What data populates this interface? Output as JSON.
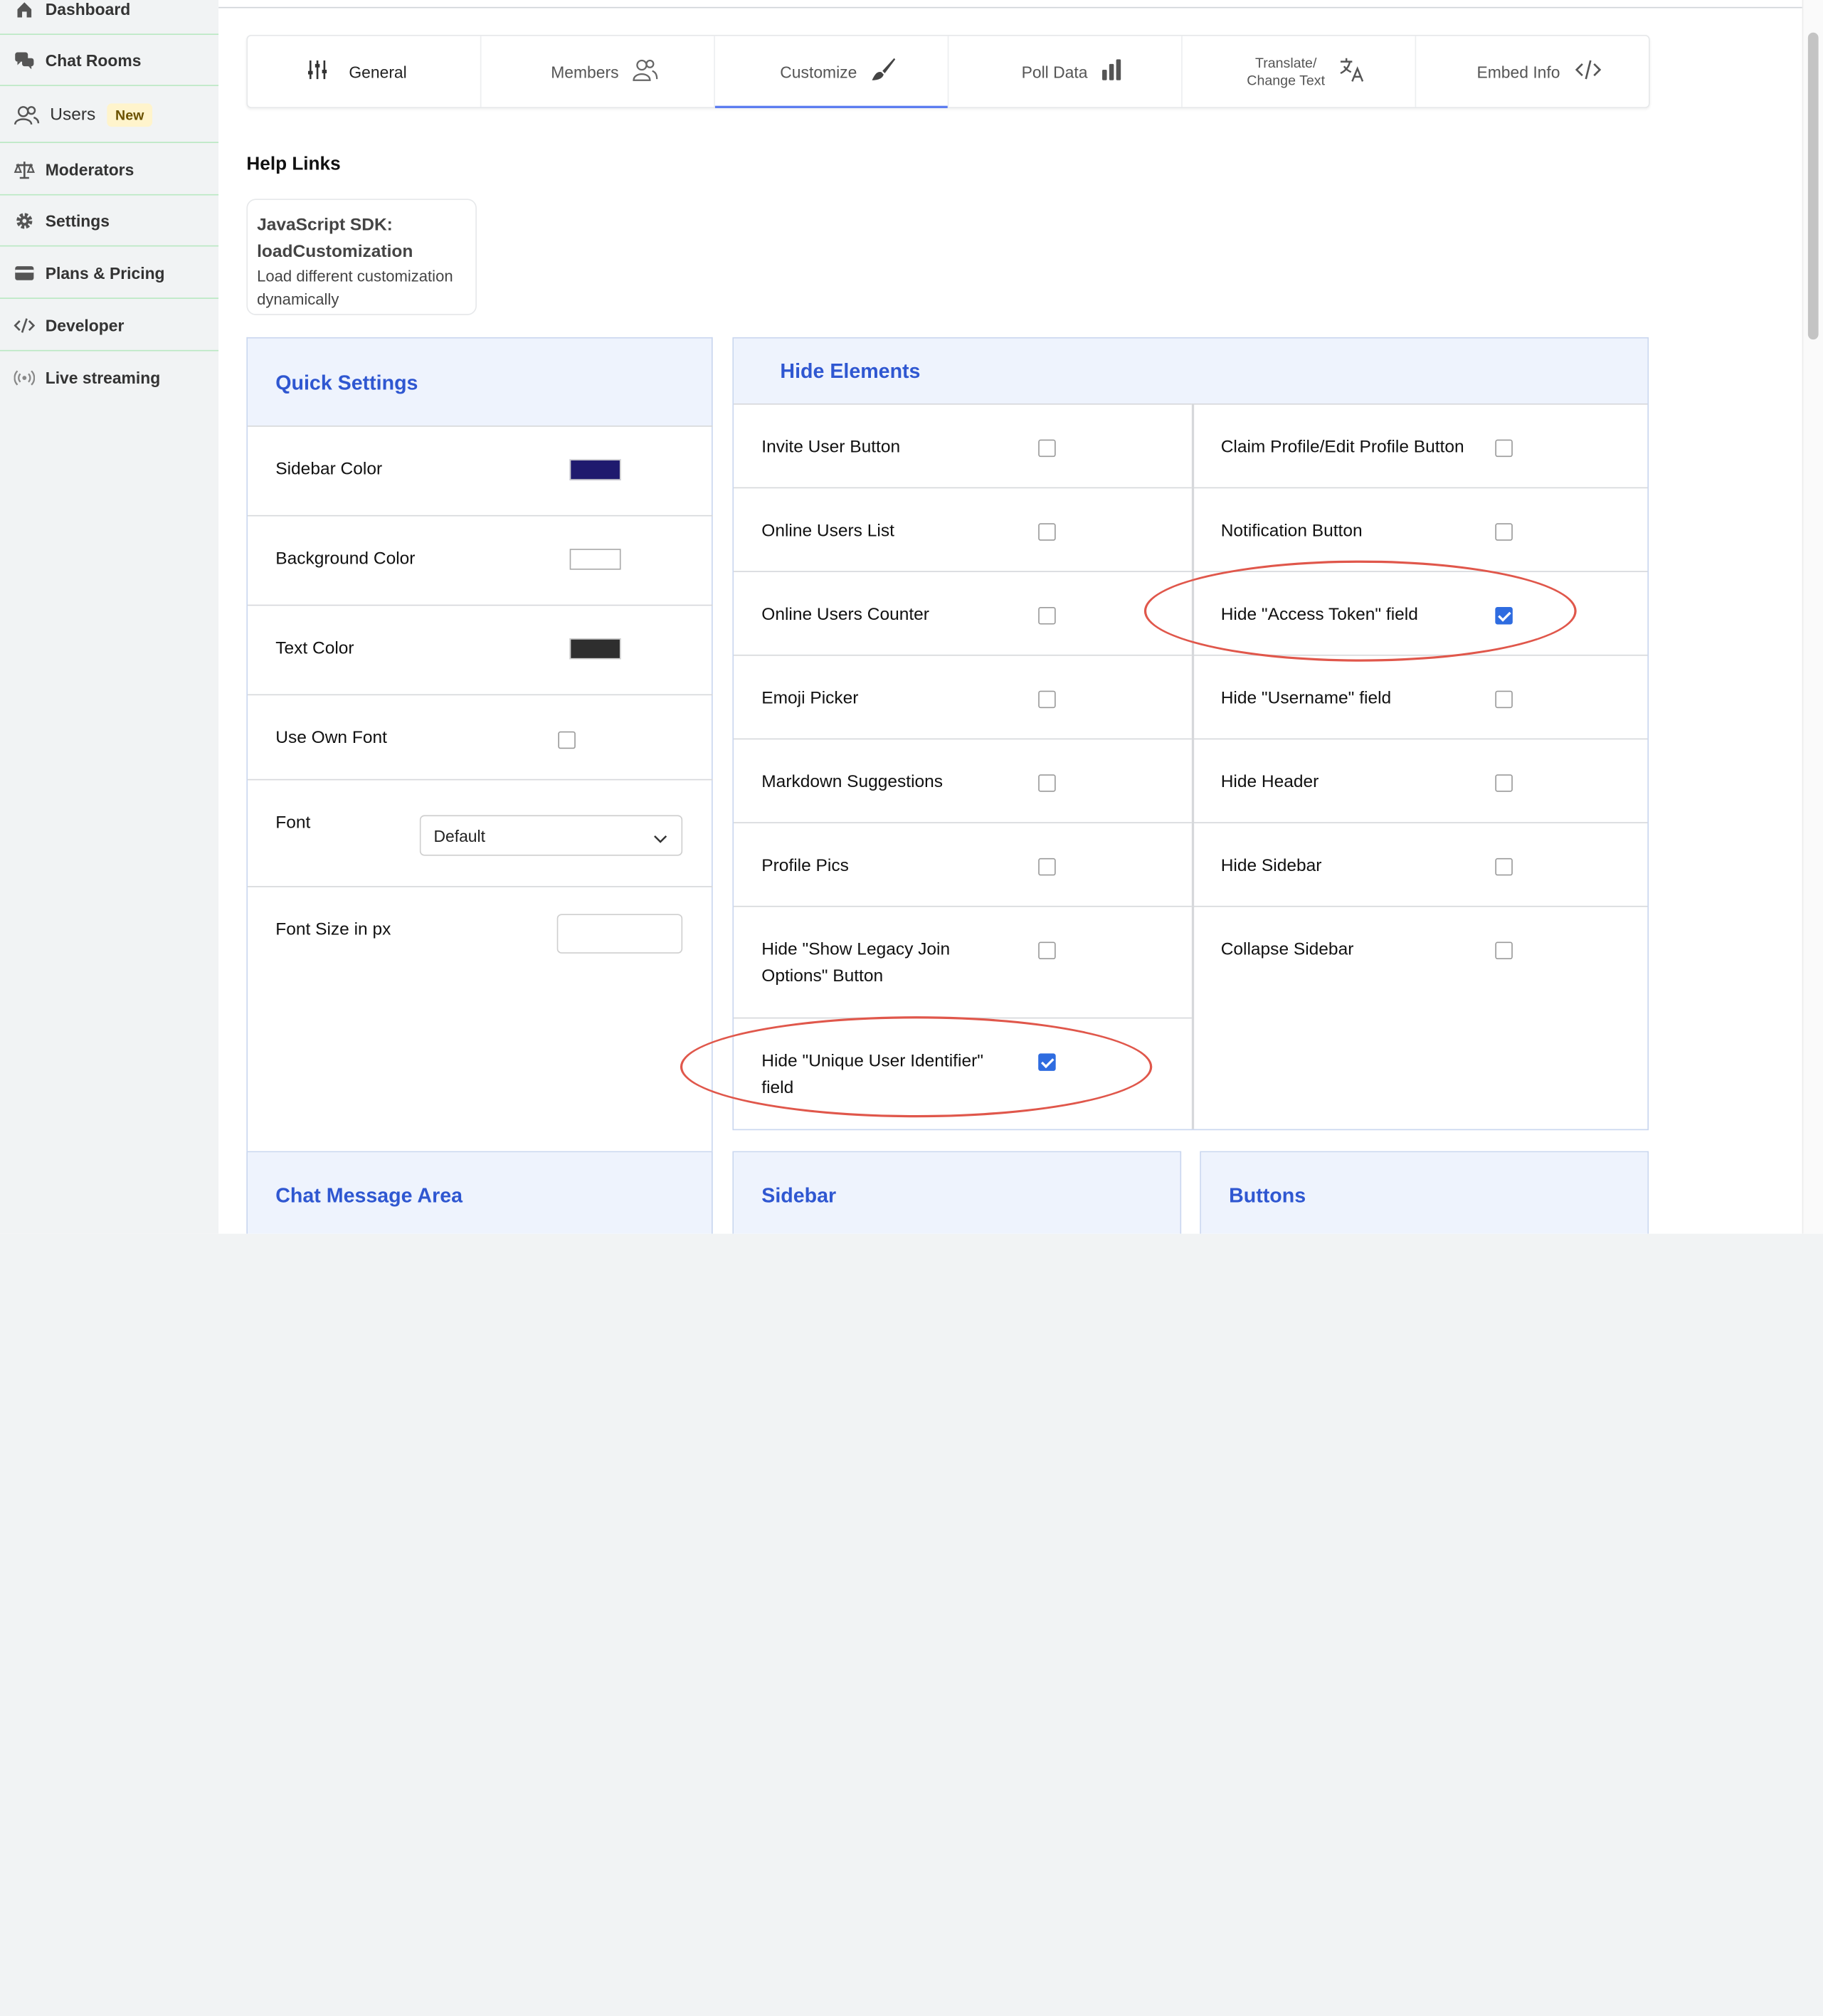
{
  "sidebar": {
    "items": [
      {
        "label": "Dashboard",
        "icon": "home-icon"
      },
      {
        "label": "Chat Rooms",
        "icon": "chat-icon"
      },
      {
        "label": "Users",
        "icon": "users-icon",
        "badge": "New"
      },
      {
        "label": "Moderators",
        "icon": "scale-icon"
      },
      {
        "label": "Settings",
        "icon": "gear-icon"
      },
      {
        "label": "Plans & Pricing",
        "icon": "card-icon"
      },
      {
        "label": "Developer",
        "icon": "code-icon"
      },
      {
        "label": "Live streaming",
        "icon": "broadcast-icon"
      }
    ]
  },
  "tabs": [
    {
      "label": "General",
      "icon": "sliders-icon"
    },
    {
      "label": "Members",
      "icon": "members-icon"
    },
    {
      "label": "Customize",
      "icon": "brush-icon",
      "active": true
    },
    {
      "label": "Poll Data",
      "icon": "bar-chart-icon"
    },
    {
      "label_line1": "Translate/",
      "label_line2": "Change Text",
      "icon": "translate-icon"
    },
    {
      "label": "Embed Info",
      "icon": "code-icon"
    }
  ],
  "help": {
    "title": "Help Links",
    "card_title_line1": "JavaScript SDK:",
    "card_title_line2": "loadCustomization",
    "card_desc_line1": "Load different customization",
    "card_desc_line2": "dynamically"
  },
  "quick_settings": {
    "title": "Quick Settings",
    "sidebar_color_label": "Sidebar Color",
    "sidebar_color": "#1f1a6e",
    "background_color_label": "Background Color",
    "background_color": "#ffffff",
    "text_color_label": "Text Color",
    "text_color": "#2e2e2e",
    "use_own_font_label": "Use Own Font",
    "use_own_font": false,
    "font_label": "Font",
    "font_value": "Default",
    "font_size_label": "Font Size in px",
    "font_size_value": ""
  },
  "hide_elements": {
    "title": "Hide Elements",
    "left": [
      {
        "label": "Invite User Button",
        "checked": false
      },
      {
        "label": "Online Users List",
        "checked": false
      },
      {
        "label": "Online Users Counter",
        "checked": false
      },
      {
        "label": "Emoji Picker",
        "checked": false
      },
      {
        "label": "Markdown Suggestions",
        "checked": false
      },
      {
        "label": "Profile Pics",
        "checked": false
      },
      {
        "label_line1": "Hide \"Show Legacy Join",
        "label_line2": "Options\" Button",
        "checked": false
      },
      {
        "label_line1": "Hide \"Unique User Identifier\"",
        "label_line2": "field",
        "checked": true
      }
    ],
    "right": [
      {
        "label": "Claim Profile/Edit Profile Button",
        "checked": false
      },
      {
        "label": "Notification Button",
        "checked": false
      },
      {
        "label": "Hide \"Access Token\" field",
        "checked": true
      },
      {
        "label": "Hide \"Username\" field",
        "checked": false
      },
      {
        "label": "Hide Header",
        "checked": false
      },
      {
        "label": "Hide Sidebar",
        "checked": false
      },
      {
        "label": "Collapse Sidebar",
        "checked": false
      }
    ]
  },
  "bottom_panels": {
    "chat_message_area": "Chat Message Area",
    "sidebar": "Sidebar",
    "buttons": "Buttons"
  },
  "colors": {
    "accent": "#2f57d1",
    "checkbox_checked": "#2f6ce0",
    "annotation_ring": "#e0574b",
    "nav_divider": "#b9e8c2"
  }
}
